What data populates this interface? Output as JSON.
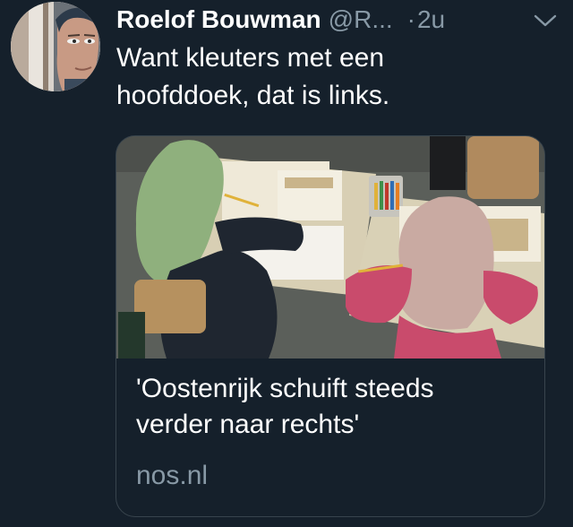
{
  "tweet": {
    "author_name": "Roelof Bouwman",
    "author_handle": "@R...",
    "separator": "·",
    "time": "2u",
    "text_lines": [
      "Want kleuters met een",
      "hoofddoek, dat is links."
    ]
  },
  "card": {
    "title_lines": [
      "'Oostenrijk schuift steeds",
      "verder naar rechts'"
    ],
    "domain": "nos.nl"
  },
  "colors": {
    "background": "#15202b",
    "text": "#ffffff",
    "secondary_text": "#8899a6",
    "card_border": "#38444d"
  },
  "icons": {
    "caret": "chevron-down-icon"
  }
}
